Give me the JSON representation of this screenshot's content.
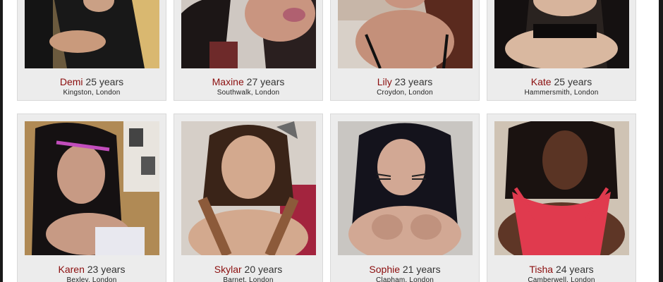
{
  "colors": {
    "name": "#8b0e0e",
    "card_bg": "#ececec"
  },
  "profiles": [
    {
      "name": "Demi",
      "age": "25 years",
      "location": "Kingston, London"
    },
    {
      "name": "Maxine",
      "age": "27 years",
      "location": "Southwalk, London"
    },
    {
      "name": "Lily",
      "age": "23 years",
      "location": "Croydon, London"
    },
    {
      "name": "Kate",
      "age": "25 years",
      "location": "Hammersmith, London"
    },
    {
      "name": "Karen",
      "age": "23 years",
      "location": "Bexley, London"
    },
    {
      "name": "Skylar",
      "age": "20 years",
      "location": "Barnet, London"
    },
    {
      "name": "Sophie",
      "age": "21 years",
      "location": "Clapham, London"
    },
    {
      "name": "Tisha",
      "age": "24 years",
      "location": "Camberwell, London"
    }
  ]
}
